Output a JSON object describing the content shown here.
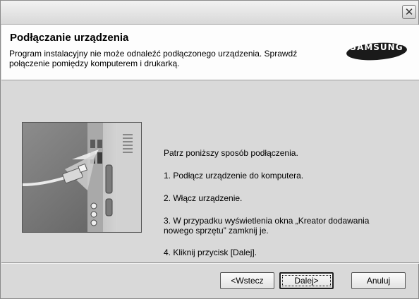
{
  "window": {
    "close_glyph": "✕"
  },
  "header": {
    "title": "Podłączanie urządzenia",
    "subtitle": "Program instalacyjny nie może odnaleźć podłączonego urządzenia. Sprawdź połączenie pomiędzy komputerem i drukarką.",
    "logo_text": "SAMSUNG",
    "logo_color": "#1a1a1a"
  },
  "content": {
    "illustration_icon": "usb-cable-to-computer-icon",
    "steps": [
      "Patrz poniższy sposób podłączenia.",
      "1. Podłącz urządzenie do komputera.",
      "2. Włącz urządzenie.",
      "3. W przypadku wyświetlenia okna „Kreator dodawania nowego sprzętu” zamknij je.",
      "4. Kliknij przycisk [Dalej]."
    ]
  },
  "buttons": {
    "back": "<Wstecz",
    "next": "Dalej>",
    "cancel": "Anuluj"
  }
}
